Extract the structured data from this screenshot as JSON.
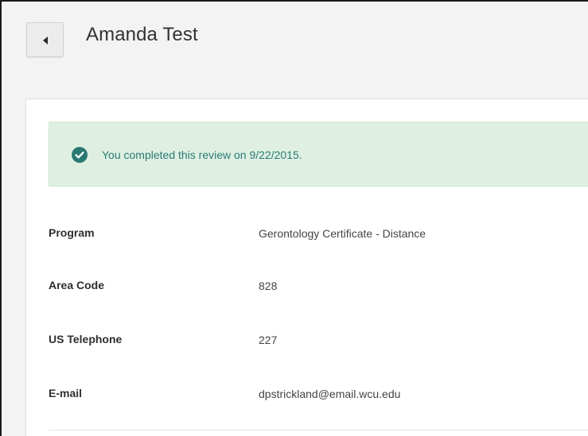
{
  "header": {
    "back_icon": "chevron-left-icon",
    "title": "Amanda Test"
  },
  "alert": {
    "icon": "check-circle-icon",
    "message": "You completed this review on 9/22/2015.",
    "background_color": "#dff0e3",
    "text_color": "#2a7a73"
  },
  "fields": [
    {
      "label": "Program",
      "value": "Gerontology Certificate - Distance"
    },
    {
      "label": "Area Code",
      "value": "828"
    },
    {
      "label": "US Telephone",
      "value": "227"
    },
    {
      "label": "E-mail",
      "value": "dpstrickland@email.wcu.edu"
    }
  ]
}
